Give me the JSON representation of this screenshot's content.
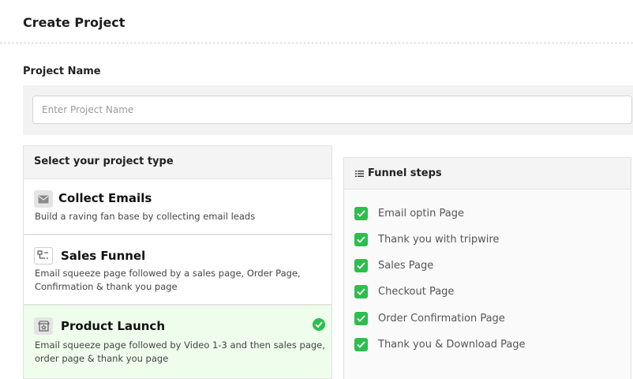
{
  "page": {
    "title": "Create Project"
  },
  "project_name": {
    "label": "Project Name",
    "placeholder": "Enter Project Name",
    "value": ""
  },
  "project_types": {
    "heading": "Select your project type",
    "items": [
      {
        "title": "Collect Emails",
        "description": "Build a raving fan base by collecting email leads",
        "icon": "envelope-icon",
        "selected": false
      },
      {
        "title": "Sales Funnel",
        "description": "Email squeeze page followed by a sales page, Order Page, Confirmation & thank you page",
        "icon": "funnel-flow-icon",
        "selected": false
      },
      {
        "title": "Product Launch",
        "description": "Email squeeze page followed by Video 1-3 and then sales page, order page & thank you page",
        "icon": "store-launch-icon",
        "selected": true
      }
    ]
  },
  "funnel_steps": {
    "heading": "Funnel steps",
    "icon": "list-icon",
    "items": [
      {
        "label": "Email optin Page",
        "checked": true
      },
      {
        "label": "Thank you with tripwire",
        "checked": true
      },
      {
        "label": "Sales Page",
        "checked": true
      },
      {
        "label": "Checkout Page",
        "checked": true
      },
      {
        "label": "Order Confirmation Page",
        "checked": true
      },
      {
        "label": "Thank you & Download Page",
        "checked": true
      }
    ]
  },
  "colors": {
    "accent_green": "#2dbe4e",
    "selected_bg": "#eefdec",
    "panel_bg": "#f4f4f4"
  }
}
